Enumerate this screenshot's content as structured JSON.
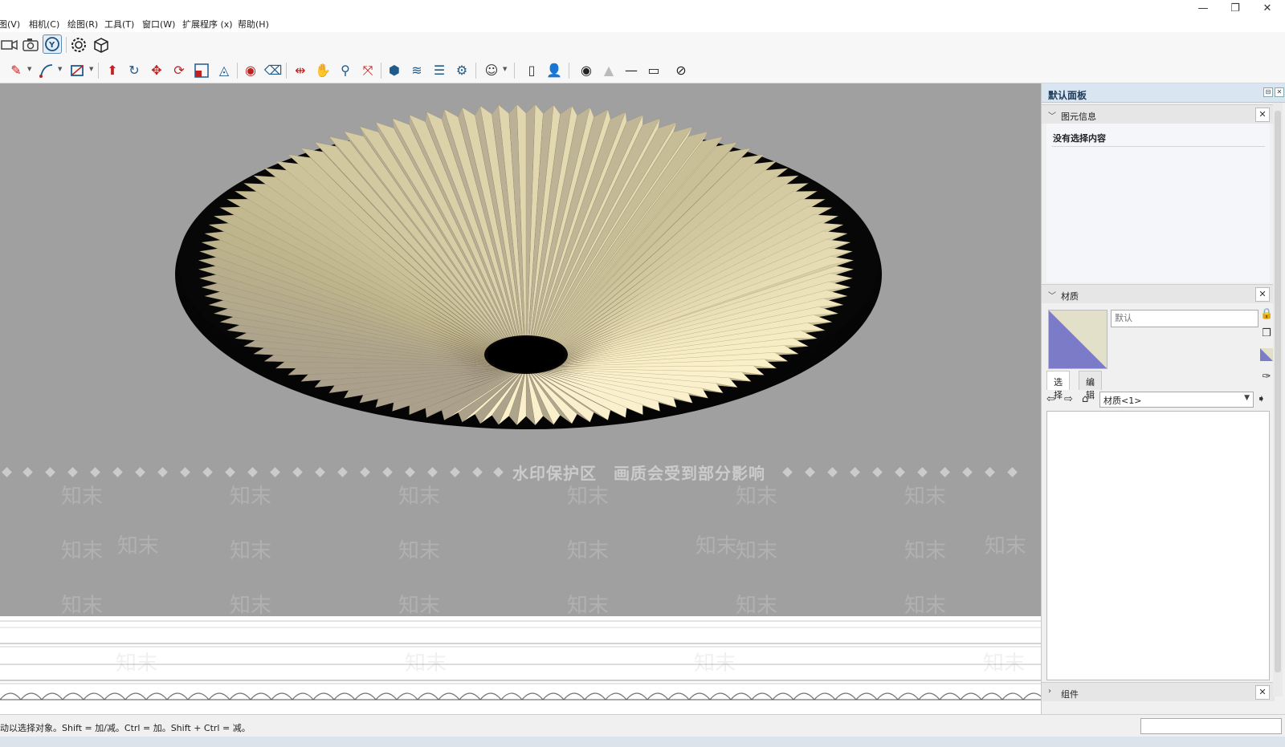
{
  "menu": {
    "items": [
      "图(V)",
      "相机(C)",
      "绘图(R)",
      "工具(T)",
      "窗口(W)",
      "扩展程序 (x)",
      "帮助(H)"
    ],
    "window_controls": [
      "—",
      "❐",
      "✕"
    ]
  },
  "toolbar1": {
    "icons": [
      "camera-video-icon",
      "camera-icon",
      "orbit-icon",
      "gear-icon",
      "cube-icon"
    ]
  },
  "toolbar2": {
    "icons": [
      "pencil-icon",
      "arc-icon",
      "rectangle-icon",
      "push-pull-icon",
      "follow-me-icon",
      "move-icon",
      "rotate-icon",
      "scale-icon",
      "offset-icon",
      "paint-icon",
      "eraser-icon",
      "tape-icon",
      "pan-icon",
      "zoom-icon",
      "zoom-extents-icon",
      "section-icon",
      "layers-icon",
      "stack-icon",
      "styles-icon",
      "user-icon",
      "page-icon",
      "person-icon",
      "point-icon",
      "cone-icon",
      "line-icon",
      "square-icon",
      "hide-icon"
    ]
  },
  "viewport": {
    "background": "#a0a0a0",
    "watermark_banner": "水印保护区　画质会受到部分影响",
    "watermark_logo": "知末"
  },
  "tray": {
    "title": "默认面板",
    "entity_info": {
      "label": "图元信息",
      "no_selection": "没有选择内容"
    },
    "materials": {
      "label": "材质",
      "name_placeholder": "默认",
      "tab_select": "选择",
      "tab_edit": "编辑",
      "library": "材质<1>",
      "swatch_colors": [
        "#7b7bc8",
        "#e2e0c8"
      ]
    },
    "components": {
      "label": "组件"
    }
  },
  "status": {
    "text": "动以选择对象。Shift = 加/减。Ctrl = 加。Shift + Ctrl = 减。"
  }
}
